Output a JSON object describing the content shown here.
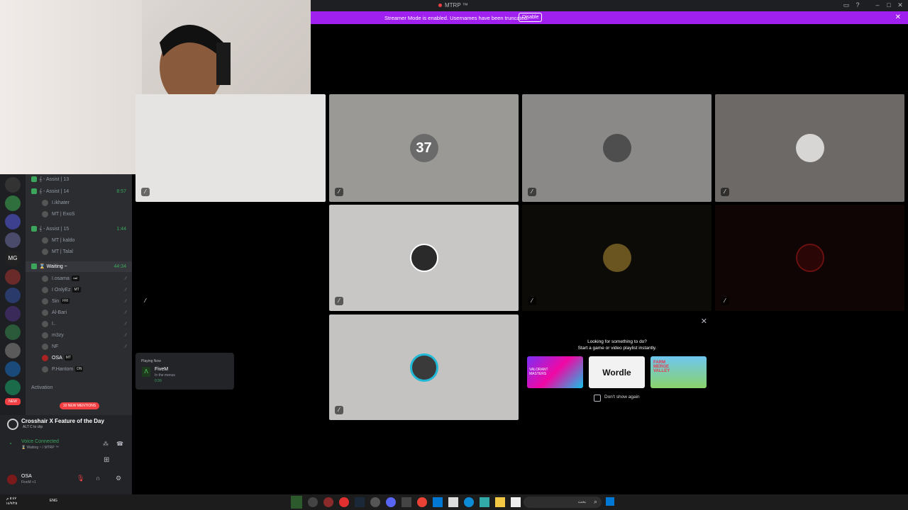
{
  "titlebar": {
    "title": "MTRP ™"
  },
  "streamer_banner": {
    "message": "Streamer Mode is enabled. Usernames have been truncated.",
    "button": "Disable"
  },
  "channels": [
    {
      "name": "𝄞 - Assist | 13",
      "time": ""
    },
    {
      "name": "𝄞 - Assist | 14",
      "time": "8:57"
    },
    {
      "name": "𝄞 - Assist | 15",
      "time": "1:44"
    },
    {
      "name": "⌛ Waiting ~",
      "time": "44:34"
    }
  ],
  "assist14_users": [
    "I.ikhater",
    "MT | ExoS"
  ],
  "assist15_users": [
    "MT | kaldo",
    "MT | Talal"
  ],
  "waiting_users": [
    {
      "name": "I.osama",
      "tag": "ثقة"
    },
    {
      "name": "I OnlyEz",
      "tag": "MT"
    },
    {
      "name": "Sin",
      "tag": "FRI"
    },
    {
      "name": "Al-Bari",
      "tag": ""
    },
    {
      "name": "I..",
      "tag": ""
    },
    {
      "name": "m3zy",
      "tag": ""
    },
    {
      "name": "NF",
      "tag": ""
    },
    {
      "name": "OSA",
      "tag": "MT"
    },
    {
      "name": "P.Hantom",
      "tag": "DN"
    }
  ],
  "category": "Activation",
  "new_mentions": "10 NEW MENTIONS",
  "feature": {
    "title": "Crosshair X Feature of the Day",
    "hint": "ALT C to clip"
  },
  "voice": {
    "status": "Voice Connected",
    "channel": "⌛ Waiting ~ / MTRP ™"
  },
  "user": {
    "name": "OSA",
    "activity": "FiveM +1"
  },
  "playing_now": {
    "label": "Playing Now",
    "game": "FiveM",
    "detail": "In the menus",
    "time": "0:39"
  },
  "tiles": [
    {
      "label": "37"
    }
  ],
  "suggest": {
    "title": "Looking for something to do?",
    "subtitle": "Start a game or video playlist instantly.",
    "games": [
      "VALORANT MASTERS",
      "Wordle",
      "FARM MERGE VALLEY"
    ],
    "checkbox": "Don't show again"
  },
  "taskbar": {
    "time": "٥:٤٧ م",
    "date": "١٤/٧/٢٥",
    "lang": "ENG",
    "search": "بحث"
  }
}
